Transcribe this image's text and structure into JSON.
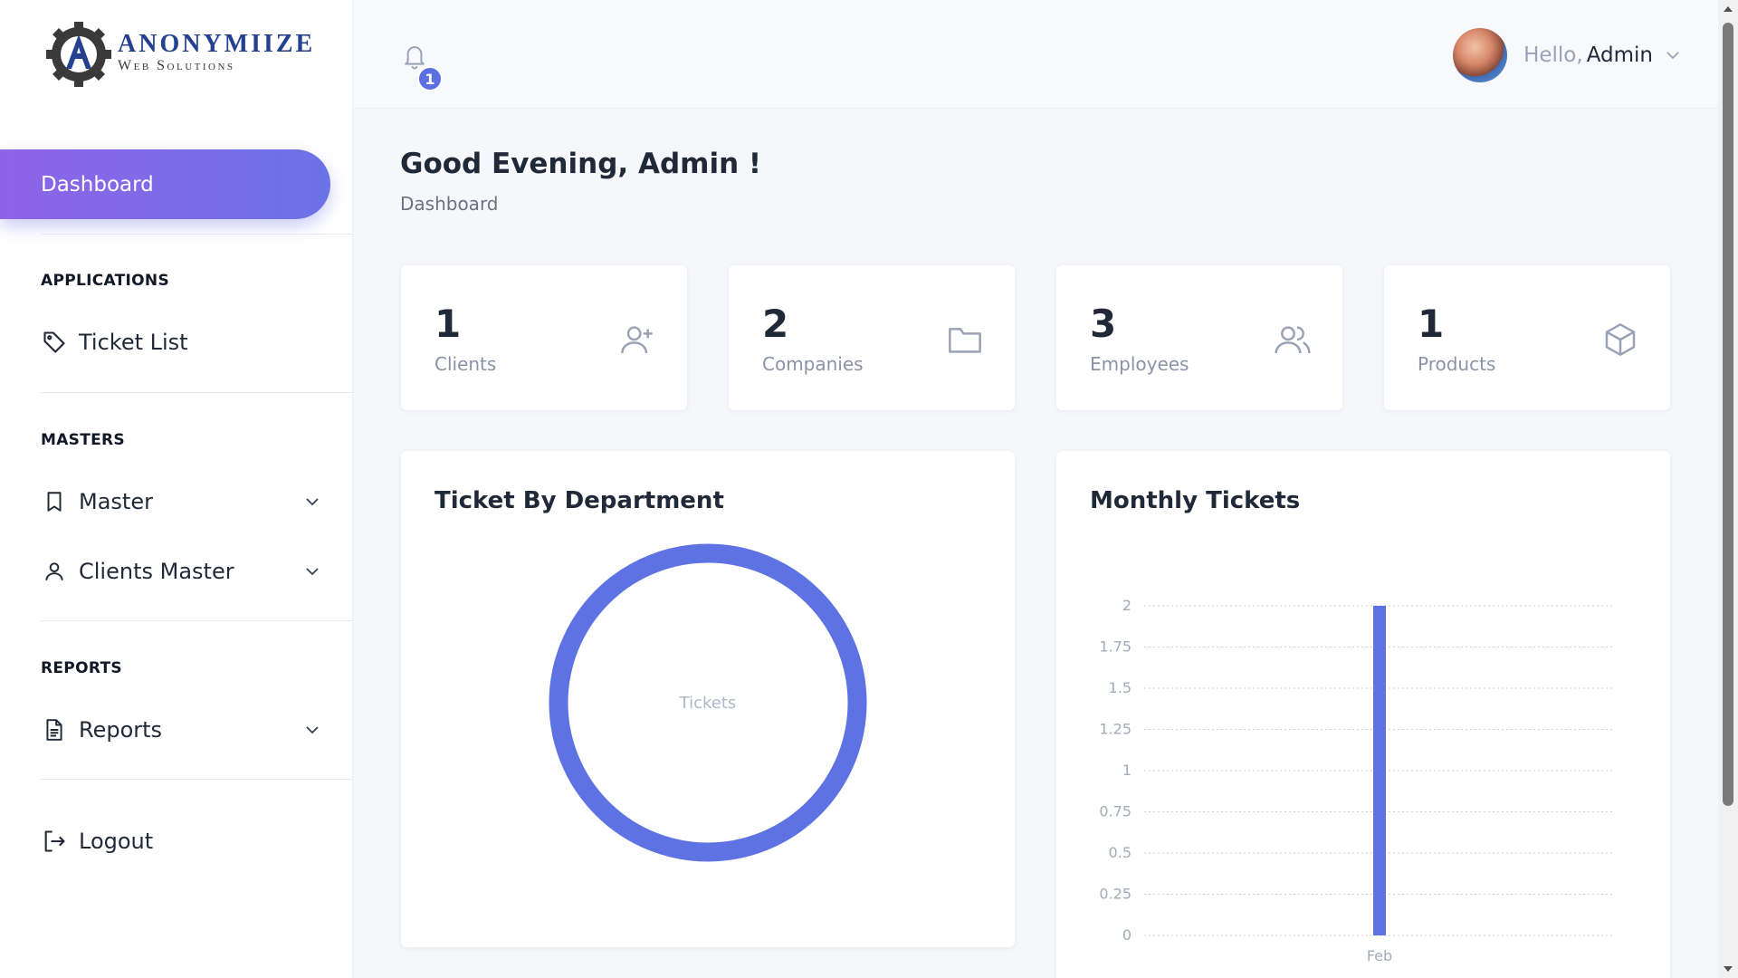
{
  "brand": {
    "title": "ANONYMIIZE",
    "subtitle": "Web Solutions"
  },
  "sidebar": {
    "active": {
      "label": "Dashboard"
    },
    "sections": [
      {
        "title": "APPLICATIONS",
        "items": [
          {
            "label": "Ticket List",
            "icon": "tag-icon"
          }
        ]
      },
      {
        "title": "MASTERS",
        "items": [
          {
            "label": "Master",
            "icon": "bookmark-icon"
          },
          {
            "label": "Clients Master",
            "icon": "user-icon"
          }
        ]
      },
      {
        "title": "REPORTS",
        "items": [
          {
            "label": "Reports",
            "icon": "document-icon"
          }
        ]
      }
    ],
    "logout": {
      "label": "Logout",
      "icon": "logout-icon"
    }
  },
  "topbar": {
    "notifications": {
      "count": "1",
      "icon": "bell-icon"
    },
    "user": {
      "greeting": "Hello,",
      "name": "Admin"
    }
  },
  "page": {
    "title": "Good Evening, Admin !",
    "breadcrumb": "Dashboard"
  },
  "stats": [
    {
      "value": "1",
      "label": "Clients",
      "icon": "user-plus-icon"
    },
    {
      "value": "2",
      "label": "Companies",
      "icon": "folder-icon"
    },
    {
      "value": "3",
      "label": "Employees",
      "icon": "users-icon"
    },
    {
      "value": "1",
      "label": "Products",
      "icon": "box-icon"
    }
  ],
  "colors": {
    "accent": "#6b73e6",
    "accent_start": "#8f63e8",
    "chart": "#5f72e4",
    "badge": "#5b6fe0"
  },
  "chart_data": [
    {
      "type": "pie",
      "title": "Ticket By Department",
      "center_label": "Tickets",
      "slices": [
        {
          "label": "",
          "value": 1
        }
      ]
    },
    {
      "type": "bar",
      "title": "Monthly Tickets",
      "categories": [
        "Feb"
      ],
      "values": [
        2
      ],
      "ylim": [
        0,
        2
      ],
      "yticks": [
        "0",
        "0.25",
        "0.5",
        "0.75",
        "1",
        "1.25",
        "1.5",
        "1.75",
        "2"
      ],
      "grid": true
    }
  ]
}
